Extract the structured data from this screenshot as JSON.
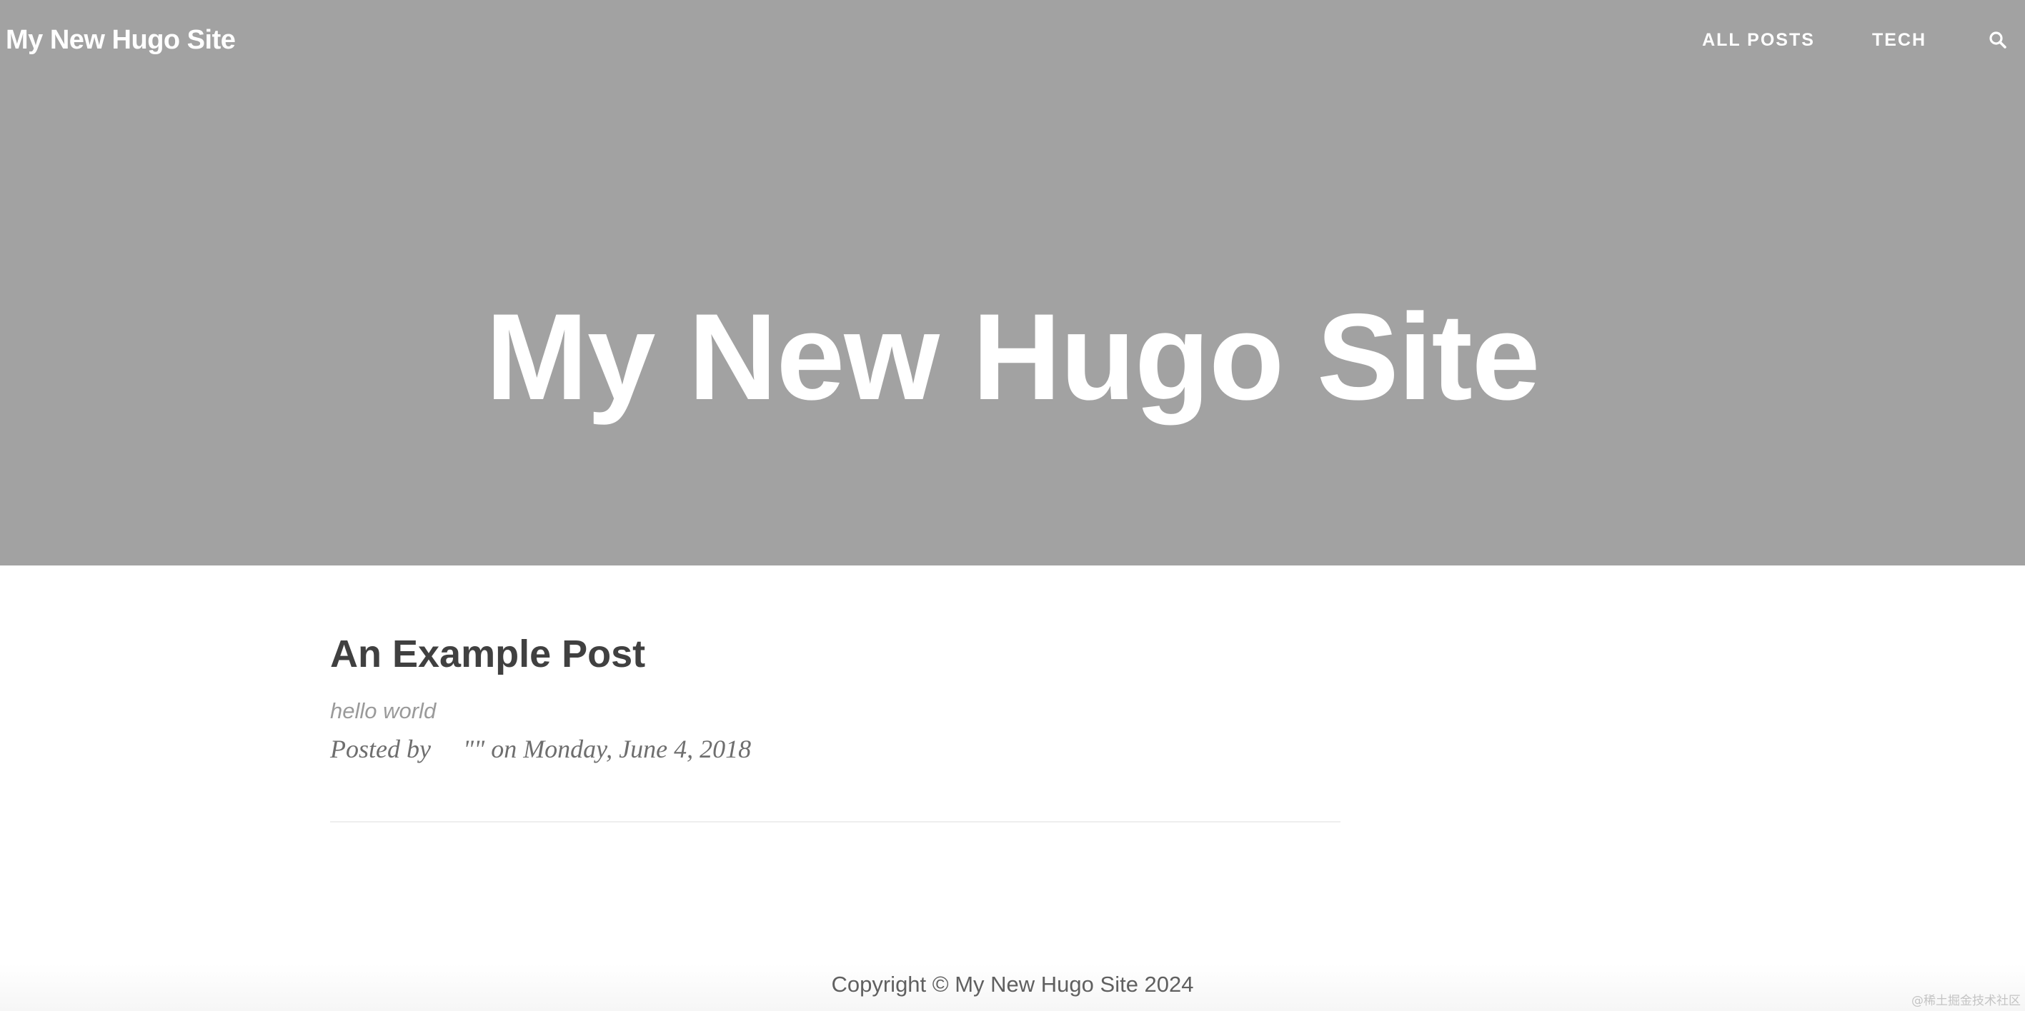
{
  "navbar": {
    "brand": "My New Hugo Site",
    "links": [
      {
        "label": "ALL POSTS"
      },
      {
        "label": "TECH"
      }
    ],
    "search_icon": "search-icon"
  },
  "hero": {
    "title": "My New Hugo Site"
  },
  "post": {
    "title": "An Example Post",
    "subtitle": "hello world",
    "meta": "Posted by     \"\" on Monday, June 4, 2018"
  },
  "footer": {
    "copyright": "Copyright © My New Hugo Site 2024"
  },
  "watermark": "@稀土掘金技术社区",
  "colors": {
    "hero_bg": "#a2a2a2",
    "title_text": "#404040",
    "subtitle_text": "#9a9a9a"
  }
}
